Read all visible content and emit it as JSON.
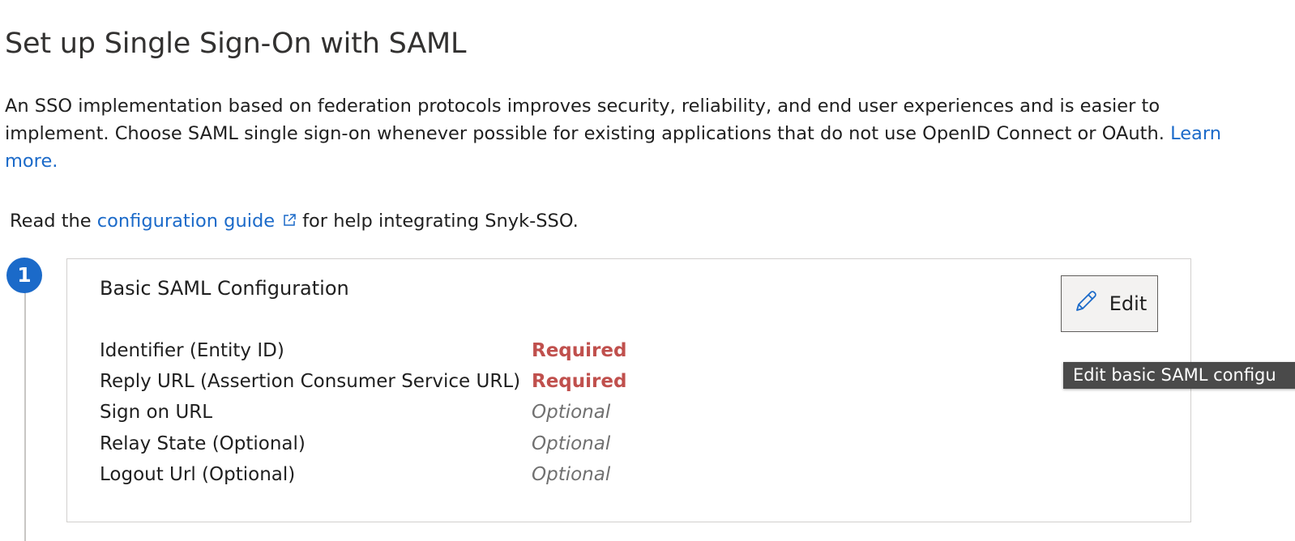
{
  "page": {
    "title": "Set up Single Sign-On with SAML",
    "intro_text": "An SSO implementation based on federation protocols improves security, reliability, and end user experiences and is easier to implement. Choose SAML single sign-on whenever possible for existing applications that do not use OpenID Connect or OAuth.",
    "learn_more_link": "Learn more.",
    "guide_prefix": "Read the",
    "guide_link": "configuration guide",
    "guide_suffix": "for help integrating Snyk-SSO."
  },
  "step": {
    "number": "1",
    "card_title": "Basic SAML Configuration",
    "edit_label": "Edit",
    "edit_tooltip": "Edit basic SAML configu",
    "fields": [
      {
        "label": "Identifier (Entity ID)",
        "status": "Required"
      },
      {
        "label": "Reply URL (Assertion Consumer Service URL)",
        "status": "Required"
      },
      {
        "label": "Sign on URL",
        "status": "Optional"
      },
      {
        "label": "Relay State (Optional)",
        "status": "Optional"
      },
      {
        "label": "Logout Url (Optional)",
        "status": "Optional"
      }
    ]
  },
  "colors": {
    "link": "#1b6ac9",
    "required": "#c0504d",
    "optional": "#707070",
    "step_badge": "#1b6ac9"
  }
}
